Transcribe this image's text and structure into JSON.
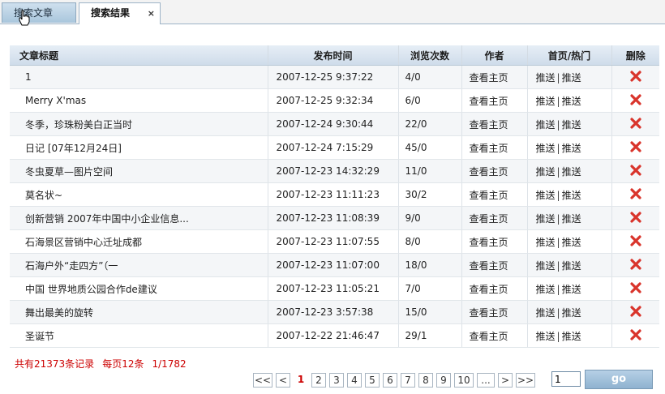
{
  "tabs": [
    {
      "label": "搜索文章",
      "active": false
    },
    {
      "label": "搜索结果",
      "active": true,
      "close": "×"
    }
  ],
  "table": {
    "headers": [
      "文章标题",
      "发布时间",
      "浏览次数",
      "作者",
      "首页/热门",
      "删除"
    ],
    "author_link": "查看主页",
    "push_home": "推送",
    "push_hot": "推送",
    "push_sep": "|",
    "rows": [
      {
        "title": "1",
        "date": "2007-12-25 9:37:22",
        "views": "4/0"
      },
      {
        "title": "Merry X'mas",
        "date": "2007-12-25 9:32:34",
        "views": "6/0"
      },
      {
        "title": "冬季，珍珠粉美白正当时",
        "date": "2007-12-24 9:30:44",
        "views": "22/0"
      },
      {
        "title": "日记 [07年12月24日]",
        "date": "2007-12-24 7:15:29",
        "views": "45/0"
      },
      {
        "title": "冬虫夏草—图片空间",
        "date": "2007-12-23 14:32:29",
        "views": "11/0"
      },
      {
        "title": "莫名状~",
        "date": "2007-12-23 11:11:23",
        "views": "30/2"
      },
      {
        "title": "创新营销 2007年中国中小企业信息...",
        "date": "2007-12-23 11:08:39",
        "views": "9/0"
      },
      {
        "title": "石海景区营销中心迁址成都",
        "date": "2007-12-23 11:07:55",
        "views": "8/0"
      },
      {
        "title": "石海户外“走四方”（一",
        "date": "2007-12-23 11:07:00",
        "views": "18/0"
      },
      {
        "title": "中国 世界地质公园合作de建议",
        "date": "2007-12-23 11:05:21",
        "views": "7/0"
      },
      {
        "title": "舞出最美的旋转",
        "date": "2007-12-23 3:57:38",
        "views": "15/0"
      },
      {
        "title": "圣诞节",
        "date": "2007-12-22 21:46:47",
        "views": "29/1"
      }
    ]
  },
  "summary": {
    "total": "共有21373条记录",
    "per_page": "每页12条",
    "page_of": "1/1782"
  },
  "pager": {
    "first": "<<",
    "prev": "<",
    "pages": [
      "1",
      "2",
      "3",
      "4",
      "5",
      "6",
      "7",
      "8",
      "9",
      "10",
      "..."
    ],
    "next": ">",
    "last": ">>",
    "current": "1",
    "input_value": "1",
    "go_label": "go"
  },
  "colors": {
    "accent_red": "#cc0000",
    "delete_icon": "#d9342b",
    "header_bg": "#d6e2ee"
  },
  "icons": {
    "delete": "x-icon",
    "cursor": "hand-cursor-icon"
  }
}
